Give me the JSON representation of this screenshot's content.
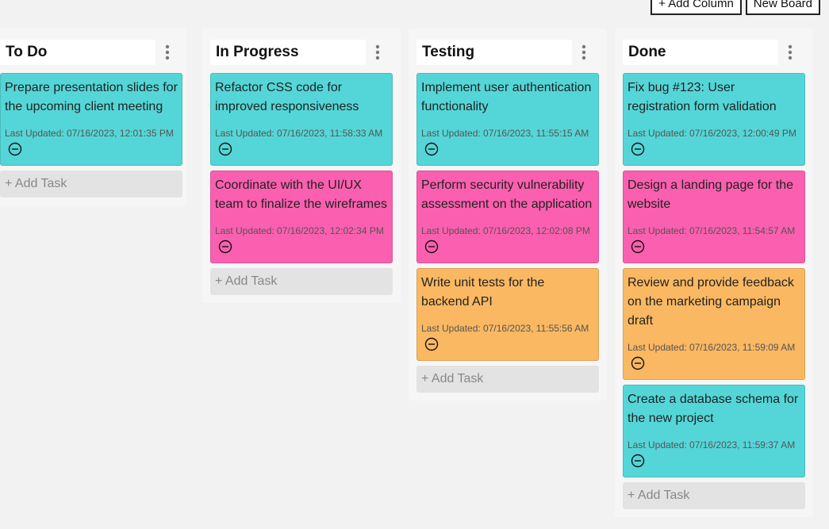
{
  "toolbar": {
    "add_column_label": "+ Add Column",
    "new_board_label": "New Board"
  },
  "colors": {
    "teal": "#54d6d8",
    "pink": "#fb5faf",
    "orange": "#fab862",
    "background": "#f2f2f2"
  },
  "icons": {
    "menu": "kebab-menu-icon",
    "remove": "minus-circle-icon"
  },
  "columns": [
    {
      "title": "To Do",
      "add_task_label": "+ Add Task",
      "tasks": [
        {
          "text": "Prepare presentation slides for the upcoming client meeting",
          "updated": "Last Updated: 07/16/2023, 12:01:35 PM",
          "color": "teal"
        }
      ]
    },
    {
      "title": "In Progress",
      "add_task_label": "+ Add Task",
      "tasks": [
        {
          "text": "Refactor CSS code for improved responsiveness",
          "updated": "Last Updated: 07/16/2023, 11:58:33 AM",
          "color": "teal"
        },
        {
          "text": "Coordinate with the UI/UX team to finalize the wireframes",
          "updated": "Last Updated: 07/16/2023, 12:02:34 PM",
          "color": "pink"
        }
      ]
    },
    {
      "title": "Testing",
      "add_task_label": "+ Add Task",
      "tasks": [
        {
          "text": "Implement user authentication functionality",
          "updated": "Last Updated: 07/16/2023, 11:55:15 AM",
          "color": "teal"
        },
        {
          "text": "Perform security vulnerability assessment on the application",
          "updated": "Last Updated: 07/16/2023, 12:02:08 PM",
          "color": "pink"
        },
        {
          "text": "Write unit tests for the backend API",
          "updated": "Last Updated: 07/16/2023, 11:55:56 AM",
          "color": "orange"
        }
      ]
    },
    {
      "title": "Done",
      "add_task_label": "+ Add Task",
      "tasks": [
        {
          "text": "Fix bug #123: User registration form validation",
          "updated": "Last Updated: 07/16/2023, 12:00:49 PM",
          "color": "teal"
        },
        {
          "text": "Design a landing page for the website",
          "updated": "Last Updated: 07/16/2023, 11:54:57 AM",
          "color": "pink"
        },
        {
          "text": "Review and provide feedback on the marketing campaign draft",
          "updated": "Last Updated: 07/16/2023, 11:59:09 AM",
          "color": "orange"
        },
        {
          "text": "Create a database schema for the new project",
          "updated": "Last Updated: 07/16/2023, 11:59:37 AM",
          "color": "teal"
        }
      ]
    }
  ]
}
